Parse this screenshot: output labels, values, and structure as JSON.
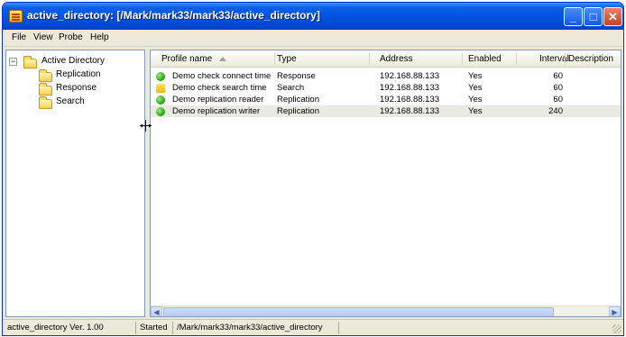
{
  "window": {
    "title": "active_directory: [/Mark/mark33/mark33/active_directory]",
    "min_glyph": "_",
    "max_glyph": "□",
    "close_glyph": "✕"
  },
  "menu": [
    "File",
    "View",
    "Probe",
    "Help"
  ],
  "tree": {
    "root": {
      "label": "Active Directory",
      "expander": "−",
      "icon": "folder-icon"
    },
    "children": [
      {
        "label": "Replication",
        "icon": "folder-icon"
      },
      {
        "label": "Response",
        "icon": "folder-icon"
      },
      {
        "label": "Search",
        "icon": "folder-icon"
      }
    ]
  },
  "list": {
    "columns": [
      "Profile name",
      "Type",
      "Address",
      "Enabled",
      "Interval",
      "Description"
    ],
    "sort_indicator": "ascending",
    "rows": [
      {
        "status": "green",
        "name": "Demo check connect time",
        "type": "Response",
        "address": "192.168.88.133",
        "enabled": "Yes",
        "interval": "60",
        "description": ""
      },
      {
        "status": "yellow",
        "name": "Demo check search time",
        "type": "Search",
        "address": "192.168.88.133",
        "enabled": "Yes",
        "interval": "60",
        "description": ""
      },
      {
        "status": "green",
        "name": "Demo replication reader",
        "type": "Replication",
        "address": "192.168.88.133",
        "enabled": "Yes",
        "interval": "60",
        "description": ""
      },
      {
        "status": "green",
        "name": "Demo replication writer",
        "type": "Replication",
        "address": "192.168.88.133",
        "enabled": "Yes",
        "interval": "240",
        "description": ""
      }
    ],
    "selected_row": 3
  },
  "scrollbar": {
    "left_arrow": "◀",
    "right_arrow": "▶"
  },
  "status": {
    "version": "active_directory Ver. 1.00",
    "state": "Started",
    "path": "/Mark/mark33/mark33/active_directory"
  },
  "colors": {
    "title_blue": "#0053e0",
    "status_green": "#1f9b12",
    "status_yellow": "#f2b90d"
  }
}
